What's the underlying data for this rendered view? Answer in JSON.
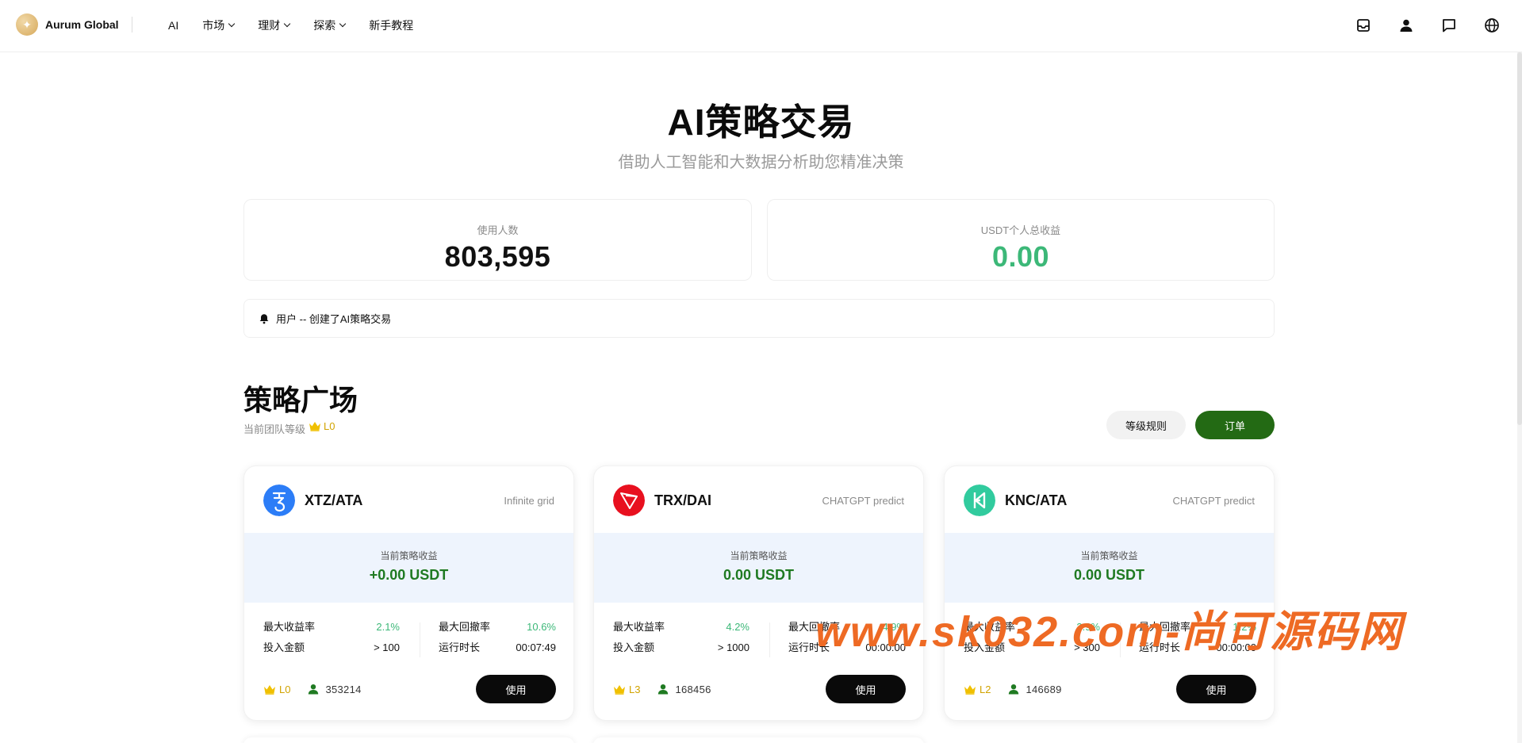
{
  "header": {
    "brand": "Aurum Global",
    "nav": [
      {
        "label": "AI",
        "dropdown": false
      },
      {
        "label": "市场",
        "dropdown": true
      },
      {
        "label": "理财",
        "dropdown": true
      },
      {
        "label": "探索",
        "dropdown": true
      },
      {
        "label": "新手教程",
        "dropdown": false
      }
    ],
    "icons": [
      "inbox-icon",
      "user-icon",
      "chat-icon",
      "globe-icon"
    ]
  },
  "hero": {
    "title": "AI策略交易",
    "subtitle": "借助人工智能和大数据分析助您精准决策"
  },
  "stats": {
    "users_label": "使用人数",
    "users_value": "803,595",
    "earnings_label": "USDT个人总收益",
    "earnings_value": "0.00"
  },
  "notice": {
    "text": "用户 -- 创建了AI策略交易"
  },
  "plaza": {
    "title": "策略广场",
    "team_level_label": "当前团队等级",
    "team_level": "L0",
    "rules_button": "等级规则",
    "orders_button": "订单"
  },
  "cards": [
    {
      "pair": "XTZ/ATA",
      "type": "Infinite grid",
      "income_label": "当前策略收益",
      "income": "+0.00 USDT",
      "max_yield_label": "最大收益率",
      "max_yield": "2.1%",
      "invest_label": "投入金额",
      "invest": "> 100",
      "drawdown_label": "最大回撤率",
      "drawdown": "10.6%",
      "runtime_label": "运行时长",
      "runtime": "00:07:49",
      "level": "L0",
      "users": "353214",
      "use_button": "使用"
    },
    {
      "pair": "TRX/DAI",
      "type": "CHATGPT predict",
      "income_label": "当前策略收益",
      "income": "0.00 USDT",
      "max_yield_label": "最大收益率",
      "max_yield": "4.2%",
      "invest_label": "投入金额",
      "invest": "> 1000",
      "drawdown_label": "最大回撤率",
      "drawdown": "4.9%",
      "runtime_label": "运行时长",
      "runtime": "00:00:00",
      "level": "L3",
      "users": "168456",
      "use_button": "使用"
    },
    {
      "pair": "KNC/ATA",
      "type": "CHATGPT predict",
      "income_label": "当前策略收益",
      "income": "0.00 USDT",
      "max_yield_label": "最大收益率",
      "max_yield": "3.9%",
      "invest_label": "投入金额",
      "invest": "> 300",
      "drawdown_label": "最大回撤率",
      "drawdown": "1.2%",
      "runtime_label": "运行时长",
      "runtime": "00:00:00",
      "level": "L2",
      "users": "146689",
      "use_button": "使用"
    }
  ],
  "watermark": "www.sk032.com-尚可源码网",
  "colors": {
    "accent_green": "#236a14",
    "profit_green": "#3cb878",
    "income_green": "#1f7a22",
    "crown_gold": "#f0c000",
    "watermark_orange": "#ee6a24"
  }
}
